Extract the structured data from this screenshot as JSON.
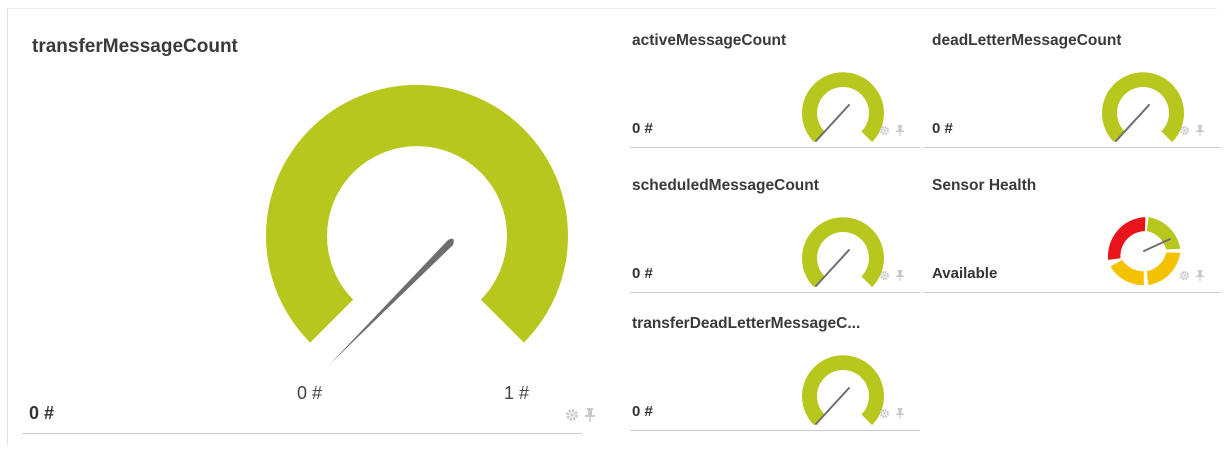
{
  "colors": {
    "gauge_fill": "#b8c71e",
    "needle": "#6e6e6e",
    "health_red": "#e8141a",
    "health_yellow": "#f5c200",
    "health_green": "#b8c71e",
    "icon_gray": "#c8c8c8"
  },
  "tiles": {
    "transfer": {
      "title": "transferMessageCount",
      "value": "0 #",
      "scale_min": "0 #",
      "scale_max": "1 #"
    },
    "active": {
      "title": "activeMessageCount",
      "value": "0 #"
    },
    "deadletter": {
      "title": "deadLetterMessageCount",
      "value": "0 #"
    },
    "scheduled": {
      "title": "scheduledMessageCount",
      "value": "0 #"
    },
    "health": {
      "title": "Sensor Health",
      "value": "Available"
    },
    "transfer_deadletter": {
      "title": "transferDeadLetterMessageC...",
      "value": "0 #"
    }
  },
  "icons": {
    "settings": "gear-icon",
    "pin": "pin-icon"
  }
}
